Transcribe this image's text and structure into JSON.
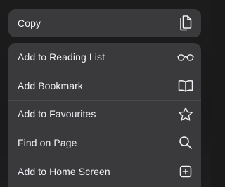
{
  "colors": {
    "menu_background": "#3a3a3c",
    "text": "#f2f2f7",
    "separator": "#4a4a4d",
    "icon": "#f2f2f7"
  },
  "copy_group": {
    "item": {
      "label": "Copy",
      "icon": "copy-icon"
    }
  },
  "actions": [
    {
      "label": "Add to Reading List",
      "icon": "glasses-icon"
    },
    {
      "label": "Add Bookmark",
      "icon": "book-icon"
    },
    {
      "label": "Add to Favourites",
      "icon": "star-icon"
    },
    {
      "label": "Find on Page",
      "icon": "search-icon"
    },
    {
      "label": "Add to Home Screen",
      "icon": "add-square-icon"
    }
  ]
}
